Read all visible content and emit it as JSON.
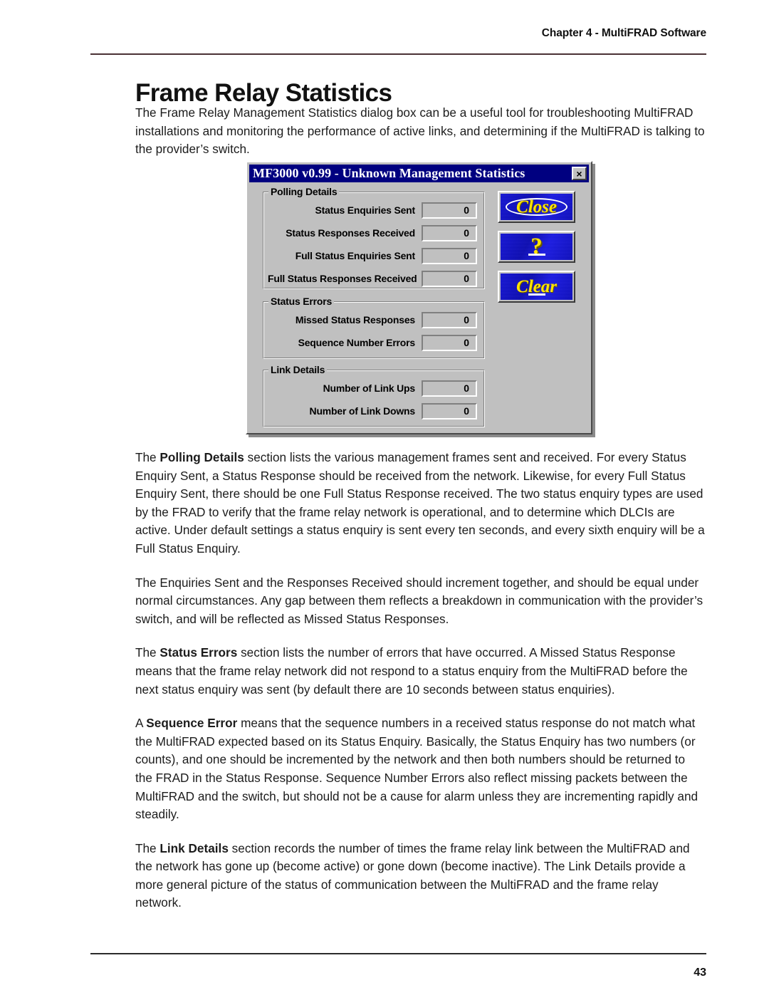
{
  "page": {
    "running_head": "Chapter 4 - MultiFRAD Software",
    "title": "Frame Relay Statistics",
    "page_number": "43"
  },
  "paragraphs": {
    "intro": "The Frame Relay Management Statistics dialog box can be a useful tool for troubleshooting MultiFRAD installations and monitoring the performance of active links, and determining if the MultiFRAD is talking to the provider’s switch.",
    "polling_lead": "The ",
    "polling_bold": "Polling Details",
    "polling_rest": " section lists the various management frames sent and received.  For every Status Enquiry Sent, a Status Response should be received from the network.  Likewise, for every Full Status Enquiry Sent, there should be one Full Status Response received.  The two status enquiry types are used by the FRAD to verify that the frame relay network is operational, and to determine which DLCIs are active.  Under default settings a status enquiry is sent every ten seconds, and every sixth enquiry will be a Full Status Enquiry.",
    "enquiries": "The Enquiries Sent and the Responses Received should increment together, and should be equal under normal circumstances.  Any gap between them reflects a breakdown in communication with the provider’s switch, and will be reflected as Missed Status Responses.",
    "status_lead": "The ",
    "status_bold": "Status Errors",
    "status_rest": " section lists the number of errors that have occurred.  A Missed Status Response means that the frame relay network did not respond to a status enquiry from the MultiFRAD before the next status enquiry was sent (by default there are 10 seconds between status enquiries).",
    "sequence_lead": "A ",
    "sequence_bold": "Sequence Error",
    "sequence_rest": " means that the sequence numbers in a received status response do not match what the MultiFRAD expected based on its Status Enquiry.  Basically, the Status Enquiry has two numbers (or counts), and one should be incremented by the network and then both numbers should be returned to the FRAD in the Status Response.  Sequence Number Errors also reflect missing packets between the MultiFRAD and the switch, but should not be a cause for alarm unless they are incrementing rapidly and steadily.",
    "link_lead": "The ",
    "link_bold": "Link Details",
    "link_rest": " section records the number of times the frame relay link between the MultiFRAD and the network has gone up (become active) or gone down (become inactive).  The Link Details provide a more general picture of the status of communication between the MultiFRAD and the frame relay network."
  },
  "dialog": {
    "title": "MF3000 v0.99 - Unknown Management Statistics",
    "close_icon_label": "×",
    "groups": {
      "polling": {
        "legend": "Polling Details",
        "fields": [
          {
            "label": "Status Enquiries Sent",
            "value": "0"
          },
          {
            "label": "Status Responses Received",
            "value": "0"
          },
          {
            "label": "Full Status Enquiries Sent",
            "value": "0"
          },
          {
            "label": "Full Status Responses Received",
            "value": "0"
          }
        ]
      },
      "status_errors": {
        "legend": "Status Errors",
        "fields": [
          {
            "label": "Missed Status Responses",
            "value": "0"
          },
          {
            "label": "Sequence Number Errors",
            "value": "0"
          }
        ]
      },
      "link_details": {
        "legend": "Link Details",
        "fields": [
          {
            "label": "Number of Link Ups",
            "value": "0"
          },
          {
            "label": "Number of Link Downs",
            "value": "0"
          }
        ]
      }
    },
    "buttons": {
      "close": "Close",
      "help": "?",
      "clear": "Clear"
    },
    "colors": {
      "titlebar": "#000080",
      "face": "#c0c0c0",
      "button_blue": "#1414d8",
      "button_yellow": "#ffe400"
    }
  }
}
